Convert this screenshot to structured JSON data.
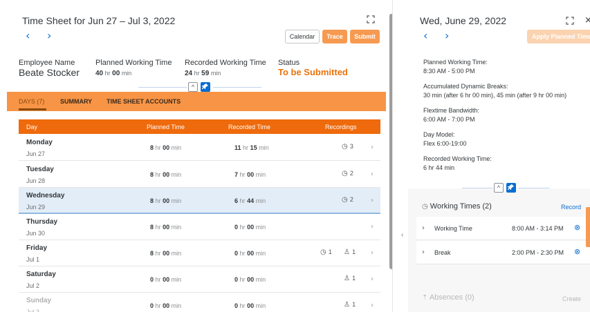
{
  "timesheet": {
    "title": "Time Sheet for Jun 27 – Jul 3, 2022",
    "buttons": {
      "calendar": "Calendar",
      "trace": "Trace",
      "submit": "Submit"
    },
    "employee_label": "Employee Name",
    "employee_name": "Beate Stocker",
    "planned_label": "Planned Working Time",
    "planned_hr": "40",
    "planned_min": "00",
    "recorded_label": "Recorded Working Time",
    "recorded_hr": "24",
    "recorded_min": "59",
    "status_label": "Status",
    "status_value": "To be Submitted",
    "unit_hr": "hr",
    "unit_min": "min",
    "tabs": [
      {
        "label": "DAYS (7)"
      },
      {
        "label": "SUMMARY"
      },
      {
        "label": "TIME SHEET ACCOUNTS"
      }
    ],
    "columns": {
      "day": "Day",
      "planned": "Planned Time",
      "recorded": "Recorded Time",
      "recordings": "Recordings"
    },
    "rows": [
      {
        "day": "Monday",
        "date": "Jun 27",
        "p_hr": "8",
        "p_min": "00",
        "r_hr": "11",
        "r_min": "15",
        "rec1": "3",
        "rec2": ""
      },
      {
        "day": "Tuesday",
        "date": "Jun 28",
        "p_hr": "8",
        "p_min": "00",
        "r_hr": "7",
        "r_min": "00",
        "rec1": "2",
        "rec2": ""
      },
      {
        "day": "Wednesday",
        "date": "Jun 29",
        "p_hr": "8",
        "p_min": "00",
        "r_hr": "6",
        "r_min": "44",
        "rec1": "2",
        "rec2": ""
      },
      {
        "day": "Thursday",
        "date": "Jun 30",
        "p_hr": "8",
        "p_min": "00",
        "r_hr": "0",
        "r_min": "00",
        "rec1": "",
        "rec2": ""
      },
      {
        "day": "Friday",
        "date": "Jul 1",
        "p_hr": "8",
        "p_min": "00",
        "r_hr": "0",
        "r_min": "00",
        "rec1": "1",
        "rec2": "1"
      },
      {
        "day": "Saturday",
        "date": "Jul 2",
        "p_hr": "0",
        "p_min": "00",
        "r_hr": "0",
        "r_min": "00",
        "rec1": "",
        "rec2": "1"
      },
      {
        "day": "Sunday",
        "date": "Jul 3",
        "p_hr": "0",
        "p_min": "00",
        "r_hr": "0",
        "r_min": "00",
        "rec1": "",
        "rec2": "1"
      }
    ]
  },
  "detail": {
    "title": "Wed, June 29, 2022",
    "apply_button": "Apply Planned Time",
    "info": [
      {
        "label": "Planned Working Time:",
        "value": "8:30 AM - 5:00 PM"
      },
      {
        "label": "Accumulated Dynamic Breaks:",
        "value": "30 min (after 6 hr 00 min), 45 min (after 9 hr 00 min)"
      },
      {
        "label": "Flextime Bandwidth:",
        "value": "6:00 AM - 7:00 PM"
      },
      {
        "label": "Day Model:",
        "value": "Flex 6:00-19:00"
      },
      {
        "label": "Recorded Working Time:",
        "value": "6 hr 44 min"
      }
    ],
    "working_times_title": "Working Times (2)",
    "record_link": "Record",
    "working_times": [
      {
        "name": "Working Time",
        "time": "8:00 AM - 3:14 PM"
      },
      {
        "name": "Break",
        "time": "2:00 PM - 2:30 PM"
      }
    ],
    "absences_title": "Absences (0)",
    "create_link": "Create"
  },
  "colors": {
    "accent": "#0a6ed1",
    "orange": "#ee6a0c",
    "tab_bg": "#f89445",
    "status": "#e9730c"
  }
}
